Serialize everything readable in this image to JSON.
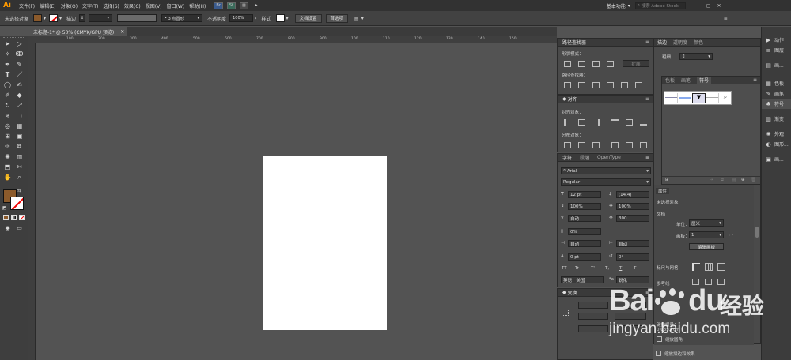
{
  "menubar": {
    "logo": "Ai",
    "items": [
      "文件(F)",
      "编辑(E)",
      "对象(O)",
      "文字(T)",
      "选择(S)",
      "效果(C)",
      "视图(V)",
      "窗口(W)",
      "帮助(H)"
    ],
    "br_button": "Br",
    "st_button": "St",
    "workspace": "基本功能",
    "search_placeholder": "搜索 Adobe Stock"
  },
  "controlbar": {
    "selection_status": "未选择对象",
    "stroke_label": "描边",
    "brush_value": "3 点圆形",
    "opacity_label": "不透明度",
    "opacity_value": "100%",
    "style_label": "样式",
    "doc_setup_button": "文档设置",
    "prefs_button": "首选项"
  },
  "document": {
    "tab_title": "未标题-1* @ 50% (CMYK/GPU 预览)",
    "ruler_ticks": [
      "100",
      "200",
      "300",
      "400",
      "500",
      "600",
      "700",
      "800",
      "900",
      "100",
      "110",
      "120",
      "130",
      "140",
      "150"
    ]
  },
  "pathfinder": {
    "tab": "路径查找器",
    "shape_modes": "形状模式：",
    "pathfinders": "路径查找器：",
    "expand": "扩展"
  },
  "align": {
    "tab": "对齐",
    "align_objects": "对齐对象：",
    "distribute_objects": "分布对象："
  },
  "character": {
    "tabs": [
      "字符",
      "段落",
      "OpenType"
    ],
    "font_family": "Arial",
    "font_style": "Regular",
    "font_size": "12 pt",
    "leading": "(14.4)",
    "h_scale": "100%",
    "v_scale": "100%",
    "kerning": "自动",
    "tracking": "300",
    "tsume": "0%",
    "aki_left": "自动",
    "aki_right": "自动",
    "baseline": "0 pt",
    "rotation": "0°",
    "type_buttons": [
      "TT",
      "Tr",
      "T'",
      "T,",
      "T",
      "T"
    ],
    "language": "英语：美国",
    "anti_alias": "锐化"
  },
  "transform": {
    "tab": "变换"
  },
  "stroke_panel": {
    "tabs": [
      "描边",
      "透明度",
      "颜色"
    ],
    "weight_label": "粗细"
  },
  "symbols_panel": {
    "tabs": [
      "色板",
      "画笔",
      "符号"
    ]
  },
  "properties": {
    "header": "属性",
    "no_selection": "未选择对象",
    "document": "文档",
    "units_label": "单位：",
    "units_value": "厘米",
    "artboard_label": "画板：",
    "artboard_value": "1",
    "edit_artboard": "编辑画板",
    "rulers_grids": "标尺与网格",
    "guides": "参考线",
    "keyboard_increment": "键盘增量：",
    "increment_value": "0.0353 cm",
    "scale_corners": "缩放圆角",
    "scale_strokes": "缩放描边和效果"
  },
  "right_dock": {
    "items": [
      {
        "icon": "▶",
        "label": "动作"
      },
      {
        "icon": "≡",
        "label": "图层"
      },
      {
        "icon": "▤",
        "label": "画..."
      },
      {
        "icon": "▦",
        "label": "色板"
      },
      {
        "icon": "✎",
        "label": "画笔"
      },
      {
        "icon": "♣",
        "label": "符号"
      },
      {
        "icon": "▥",
        "label": "渐变"
      },
      {
        "icon": "✺",
        "label": "外观"
      },
      {
        "icon": "◐",
        "label": "图形..."
      },
      {
        "icon": "▣",
        "label": "画..."
      }
    ]
  },
  "watermark": {
    "brand": "Bai",
    "brand_tail": "du",
    "jingyan": "经验",
    "url": "jingyan.baidu.com"
  },
  "colors": {
    "fill": "#8b5a2b",
    "accent": "#ff9a00",
    "canvas": "#535353",
    "watermark": "#ffffff"
  }
}
